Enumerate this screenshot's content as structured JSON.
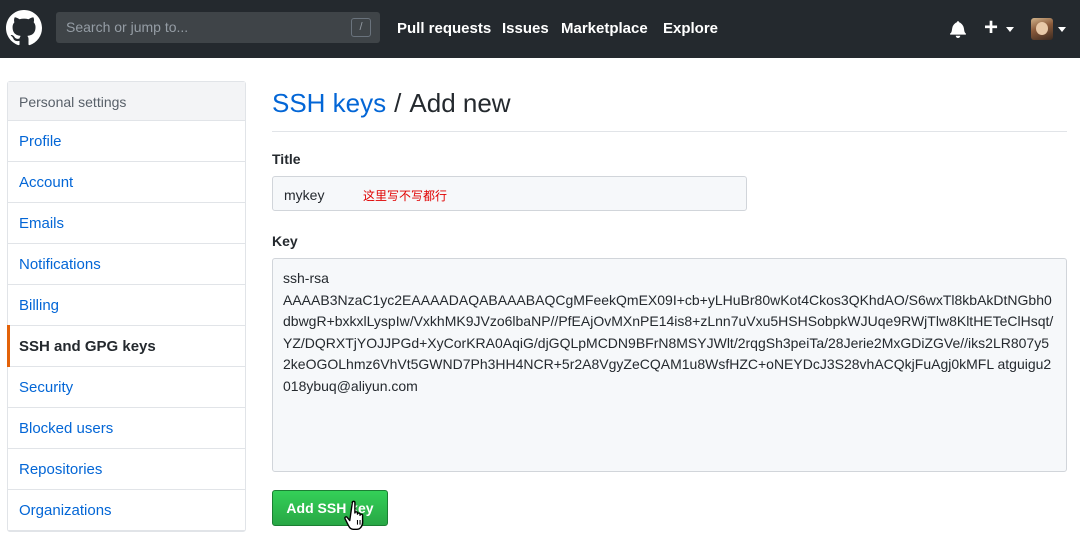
{
  "header": {
    "search": {
      "placeholder": "Search or jump to...",
      "shortcut_key": "/"
    },
    "nav": [
      {
        "label": "Pull requests"
      },
      {
        "label": "Issues"
      },
      {
        "label": "Marketplace"
      },
      {
        "label": "Explore"
      }
    ],
    "icons": [
      "github-logo",
      "bell-icon",
      "plus-icon",
      "avatar"
    ]
  },
  "sidebar": {
    "heading": "Personal settings",
    "items": [
      {
        "label": "Profile",
        "selected": false
      },
      {
        "label": "Account",
        "selected": false
      },
      {
        "label": "Emails",
        "selected": false
      },
      {
        "label": "Notifications",
        "selected": false
      },
      {
        "label": "Billing",
        "selected": false
      },
      {
        "label": "SSH and GPG keys",
        "selected": true
      },
      {
        "label": "Security",
        "selected": false
      },
      {
        "label": "Blocked users",
        "selected": false
      },
      {
        "label": "Repositories",
        "selected": false
      },
      {
        "label": "Organizations",
        "selected": false
      }
    ]
  },
  "main": {
    "breadcrumb": "SSH keys",
    "separator": "/",
    "title": "Add new",
    "title_label": "Title",
    "title_value": "mykey",
    "annotation": "这里写不写都行",
    "key_label": "Key",
    "key_value": "ssh-rsa\nAAAAB3NzaC1yc2EAAAADAQABAAABAQCgMFeekQmEX09I+cb+yLHuBr80wKot4Ckos3QKhdAO/S6wxTl8kbAkDtNGbh0dbwgR+bxkxlLyspIw/VxkhMK9JVzo6lbaNP//PfEAjOvMXnPE14is8+zLnn7uVxu5HSHSobpkWJUqe9RWjTlw8KltHETeClHsqt/YZ/DQRXTjYOJJPGd+XyCorKRA0AqiG/djGQLpMCDN9BFrN8MSYJWlt/2rqgSh3peiTa/28Jerie2MxGDiZGVe//iks2LR807y52keOGOLhmz6VhVt5GWND7Ph3HH4NCR+5r2A8VgyZeCQAM1u8WsfHZC+oNEYDcJ3S28vhACQkjFuAgj0kMFL atguigu2018ybuq@aliyun.com",
    "submit_label": "Add SSH key"
  },
  "colors": {
    "header_bg": "#24292e",
    "link_blue": "#0366d6",
    "selected_accent": "#e36209",
    "button_green": "#28a745",
    "annotation_red": "#e00000"
  }
}
